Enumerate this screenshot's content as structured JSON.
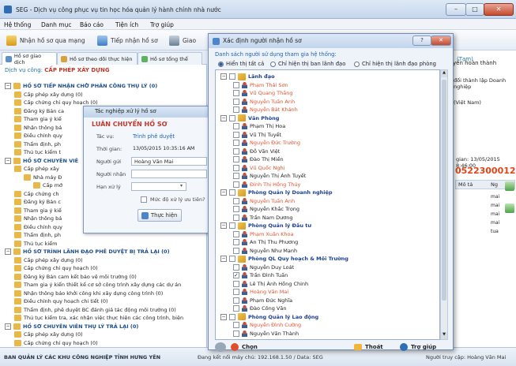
{
  "app": {
    "title": "SEG - Dịch vụ công phục vụ tin học hóa quản lý hành chính nhà nước"
  },
  "menu": [
    "Hệ thống",
    "Danh mục",
    "Báo cáo",
    "Tiện ích",
    "Trợ giúp"
  ],
  "toolbar": {
    "receive": "Nhận hồ sơ qua mạng",
    "accept": "Tiếp nhận hồ sơ",
    "collapsed": "Giao"
  },
  "tabs": [
    "Hồ sơ giao dịch",
    "Hồ sơ theo dõi thực hiện",
    "Hồ sơ tổng thể"
  ],
  "service": {
    "label": "Dịch vụ công:",
    "value": "CẤP PHÉP XÂY DỰNG"
  },
  "left_tree": [
    {
      "text": "HỒ SƠ TIẾP NHẬN CHỜ PHÂN CÔNG THỤ LÝ (0)",
      "lvl": 0,
      "bold": true
    },
    {
      "text": "Cấp phép xây dựng (0)",
      "lvl": 1
    },
    {
      "text": "Cấp chứng chỉ quy hoạch (0)",
      "lvl": 1
    },
    {
      "text": "Đăng ký Bản ca",
      "lvl": 1
    },
    {
      "text": "Tham gia ý kiế",
      "lvl": 1
    },
    {
      "text": "Nhận thông bá",
      "lvl": 1
    },
    {
      "text": "Điều chỉnh quy",
      "lvl": 1
    },
    {
      "text": "Thẩm định, ph",
      "lvl": 1
    },
    {
      "text": "Thủ tục kiểm t",
      "lvl": 1
    },
    {
      "text": "HỒ SƠ CHUYÊN VIÊ",
      "lvl": 0,
      "bold": true
    },
    {
      "text": "Cấp phép xây",
      "lvl": 1
    },
    {
      "text": "Nhà máy Đ",
      "lvl": 2
    },
    {
      "text": "Cấp mớ",
      "lvl": 3
    },
    {
      "text": "Cấp chứng ch",
      "lvl": 1
    },
    {
      "text": "Đăng ký Bản c",
      "lvl": 1
    },
    {
      "text": "Tham gia ý kiế",
      "lvl": 1
    },
    {
      "text": "Nhận thông bá",
      "lvl": 1
    },
    {
      "text": "Điều chỉnh quy",
      "lvl": 1
    },
    {
      "text": "Thẩm định, ph",
      "lvl": 1
    },
    {
      "text": "Thủ tục kiểm",
      "lvl": 1
    },
    {
      "text": "HỒ SƠ TRÌNH LÃNH ĐẠO PHÊ DUYỆT BỊ TRẢ LẠI (0)",
      "lvl": 0,
      "bold": true
    },
    {
      "text": "Cấp phép xây dựng (0)",
      "lvl": 1
    },
    {
      "text": "Cấp chứng chỉ quy hoạch (0)",
      "lvl": 1
    },
    {
      "text": "Đăng ký Bản cam kết bảo vệ môi trường (0)",
      "lvl": 1
    },
    {
      "text": "Tham gia ý kiến thiết kế cơ sở công trình xây dựng các dự án",
      "lvl": 1
    },
    {
      "text": "Nhận thông báo khởi công khi xây dựng công trình (0)",
      "lvl": 1
    },
    {
      "text": "Điều chỉnh quy hoạch chi tiết (0)",
      "lvl": 1
    },
    {
      "text": "Thẩm định, phê duyệt BC đánh giá tác động môi trường (0)",
      "lvl": 1
    },
    {
      "text": "Thủ tục kiểm tra, xác nhận việc thực hiện các công trình, biện",
      "lvl": 1
    },
    {
      "text": "HỒ SƠ CHUYÊN VIÊN THỤ LÝ TRẢ LẠI (0)",
      "lvl": 0,
      "bold": true
    },
    {
      "text": "Cấp phép xây dựng (0)",
      "lvl": 1
    },
    {
      "text": "Cấp chứng chỉ quy hoạch (0)",
      "lvl": 1
    },
    {
      "text": "Đăng ký Bản cam kết bảo vệ môi trường (0)",
      "lvl": 1
    }
  ],
  "right_panel": {
    "r1": "yển hoàn thành",
    "r2": "(Tạm)",
    "r3": "đối thành lập Doanh nghiệp",
    "r4": "(Việt Nam)",
    "date": "gian: 13/05/2015 8:46:00",
    "code": "05223000126",
    "col1": "Mô tả",
    "col2": "Ng",
    "cells": [
      "mai",
      "mai",
      "mai",
      "mai",
      "tua"
    ]
  },
  "dlg1": {
    "title": "Tác nghiệp xử lý hồ sơ",
    "heading": "LUÂN CHUYỂN HỒ SƠ",
    "action_lbl": "Tác vụ:",
    "action_val": "Trình phê duyệt",
    "time_lbl": "Thời gian:",
    "time_val": "13/05/2015 10:35:16 AM",
    "sender_lbl": "Người gửi",
    "sender_val": "Hoàng Văn Mai",
    "recv_lbl": "Người nhận",
    "due_lbl": "Hạn xử lý",
    "priority": "Mức độ xử lý ưu tiên?",
    "exec": "Thực hiện"
  },
  "dlg2": {
    "title": "Xác định người nhận hồ sơ",
    "subtitle": "Danh sách người sử dụng tham gia hệ thống:",
    "options": [
      "Hiển thị tất cả",
      "Chỉ hiện thị ban lãnh đạo",
      "Chỉ hiện thị lãnh đạo phòng"
    ],
    "choose": "Chọn",
    "exit": "Thoát",
    "help": "Trợ giúp"
  },
  "tree2": [
    {
      "t": "Lãnh đạo",
      "g": true
    },
    {
      "t": "Phạm Thái Sơn",
      "r": true
    },
    {
      "t": "Vũ Quang Thắng",
      "r": true
    },
    {
      "t": "Nguyễn Tuấn Anh",
      "r": true
    },
    {
      "t": "Nguyễn Bát Khánh",
      "r": true
    },
    {
      "t": "Văn Phòng",
      "g": true
    },
    {
      "t": "Phạm Thị Hoa"
    },
    {
      "t": "Vũ Thị Tuyết"
    },
    {
      "t": "Nguyễn Đức Trường",
      "r": true
    },
    {
      "t": "Đỗ Văn Việt"
    },
    {
      "t": "Đào Thị Miền"
    },
    {
      "t": "Vũ Quốc Nghị",
      "r": true
    },
    {
      "t": "Nguyễn Thị Ánh Tuyết"
    },
    {
      "t": "Đinh Thị Hồng Thúy",
      "r": true
    },
    {
      "t": "Phòng Quản lý Doanh nghiệp",
      "g": true
    },
    {
      "t": "Nguyễn Tuấn Anh",
      "r": true
    },
    {
      "t": "Nguyễn Khắc Trọng"
    },
    {
      "t": "Trần Nam Dương"
    },
    {
      "t": "Phòng Quản lý Đầu tư",
      "g": true
    },
    {
      "t": "Phạm Xuân Khoa",
      "r": true
    },
    {
      "t": "An Thị Thu Phương"
    },
    {
      "t": "Nguyễn Như Mạnh"
    },
    {
      "t": "Phòng QL Quy hoạch & Môi Trường",
      "g": true
    },
    {
      "t": "Nguyễn Duy Loát"
    },
    {
      "t": "Trần Đình Tuấn",
      "c": true
    },
    {
      "t": "Lê Thị Ánh Hồng Chinh"
    },
    {
      "t": "Hoàng Văn Mai",
      "r": true
    },
    {
      "t": "Phạm Đức Nghĩa"
    },
    {
      "t": "Đào Công Văn"
    },
    {
      "t": "Phòng Quản lý Lao động",
      "g": true
    },
    {
      "t": "Nguyễn Đình Cường",
      "r": true
    },
    {
      "t": "Nguyễn Văn Thành"
    }
  ],
  "status": {
    "left": "BAN QUẢN LÝ CÁC KHU CÔNG NGHIỆP TỈNH HƯNG YÊN",
    "mid": "Đang kết nối máy chủ: 192.168.1.50 / Data: SEG",
    "right": "Người truy cập: Hoàng Văn Mai"
  }
}
